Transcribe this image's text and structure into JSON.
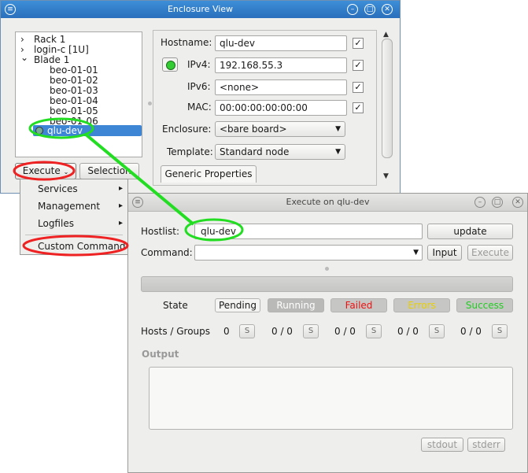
{
  "enclosure_view": {
    "title": "Enclosure View",
    "tree": [
      {
        "label": "Rack 1",
        "arrow": "›"
      },
      {
        "label": "login-c [1U]",
        "arrow": "›"
      },
      {
        "label": "Blade 1",
        "arrow": "⌄"
      },
      {
        "label": "beo-01-01"
      },
      {
        "label": "beo-01-02"
      },
      {
        "label": "beo-01-03"
      },
      {
        "label": "beo-01-04"
      },
      {
        "label": "beo-01-05"
      },
      {
        "label": "beo-01-06"
      },
      {
        "label": "qlu-dev"
      }
    ],
    "execute_label": "Execute",
    "selection_label": "Selection",
    "hostname_label": "Hostname:",
    "hostname_value": "qlu-dev",
    "ipv4_label": "IPv4:",
    "ipv4_value": "192.168.55.3",
    "ipv6_label": "IPv6:",
    "ipv6_value": "<none>",
    "mac_label": "MAC:",
    "mac_value": "00:00:00:00:00:00",
    "enclosure_label": "Enclosure:",
    "enclosure_value": "<bare board>",
    "template_label": "Template:",
    "template_value": "Standard node",
    "generic_tab": "Generic Properties",
    "check_mark": "✓"
  },
  "execute_menu": {
    "items": [
      {
        "label": "Services",
        "submenu": "▸"
      },
      {
        "label": "Management",
        "submenu": "▸"
      },
      {
        "label": "Logfiles",
        "submenu": "▸"
      },
      {
        "label": "Custom Command"
      }
    ]
  },
  "execute_dialog": {
    "title": "Execute on qlu-dev",
    "hostlist_label": "Hostlist:",
    "hostlist_value": "qlu-dev",
    "update_label": "update",
    "command_label": "Command:",
    "command_value": "",
    "input_label": "Input",
    "execute_label": "Execute",
    "state_label": "State",
    "states": [
      {
        "label": "Pending",
        "color": "#1a1a1a",
        "bg": "#f4f4f2"
      },
      {
        "label": "Running",
        "color": "#ffffff",
        "bg": "#b9b9b7"
      },
      {
        "label": "Failed",
        "color": "#ee1111",
        "bg": "#c6c6c4"
      },
      {
        "label": "Errors",
        "color": "#e8d000",
        "bg": "#c6c6c4"
      },
      {
        "label": "Success",
        "color": "#22cc22",
        "bg": "#c6c6c4"
      }
    ],
    "hosts_groups_label": "Hosts / Groups",
    "counts": [
      "0",
      "0 / 0",
      "0 / 0",
      "0 / 0",
      "0 / 0"
    ],
    "s_label": "S",
    "output_label": "Output",
    "stdout_label": "stdout",
    "stderr_label": "stderr"
  },
  "annotations": {
    "green": "#22dd22",
    "red": "#ee2222"
  }
}
